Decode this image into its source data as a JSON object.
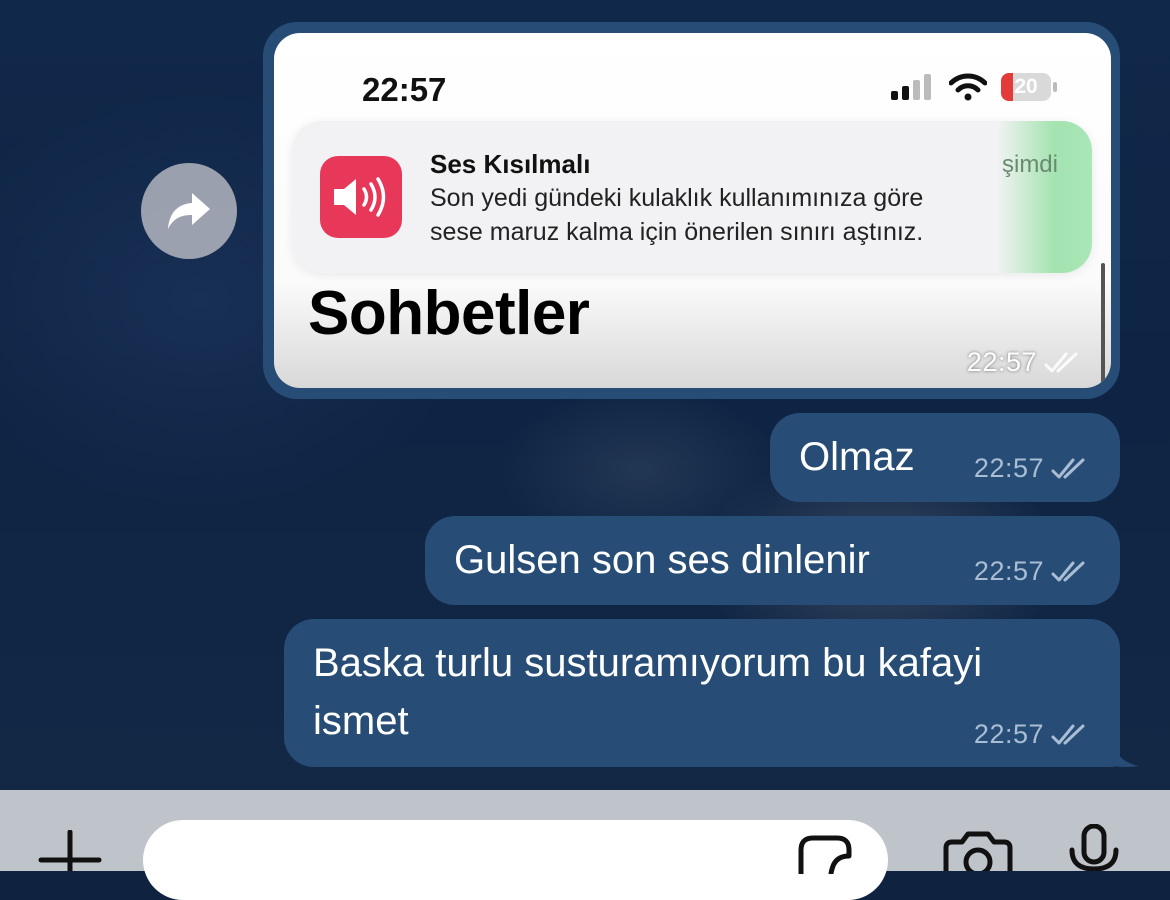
{
  "image_message": {
    "screenshot": {
      "clock": "22:57",
      "battery": "20",
      "notification": {
        "app_icon": "speaker-icon",
        "title": "Ses Kısılmalı",
        "time": "şimdi",
        "body_line1": "Son yedi gündeki kulaklık kullanımınıza göre",
        "body_line2": "sese maruz kalma için önerilen sınırı aştınız."
      },
      "heading": "Sohbetler"
    },
    "time": "22:57",
    "status": "read-double-check"
  },
  "forward_button": {
    "icon": "forward-icon"
  },
  "messages": [
    {
      "text": "Olmaz",
      "time": "22:57",
      "status": "read-double-check"
    },
    {
      "text": "Gulsen son ses dinlenir",
      "time": "22:57",
      "status": "read-double-check"
    },
    {
      "text_line1": "Baska turlu susturamıyorum bu kafayi",
      "text_line2": "ismet",
      "time": "22:57",
      "status": "read-double-check"
    }
  ],
  "input_bar": {
    "attach_icon": "plus-icon",
    "message_placeholder": "",
    "sticker_icon": "sticker-icon",
    "camera_icon": "camera-icon",
    "mic_icon": "microphone-icon"
  },
  "colors": {
    "outgoing_bubble": "#274d76",
    "chat_background": "#0f2340",
    "input_bar": "#bfc4cb",
    "notification_app": "#e8385a"
  }
}
